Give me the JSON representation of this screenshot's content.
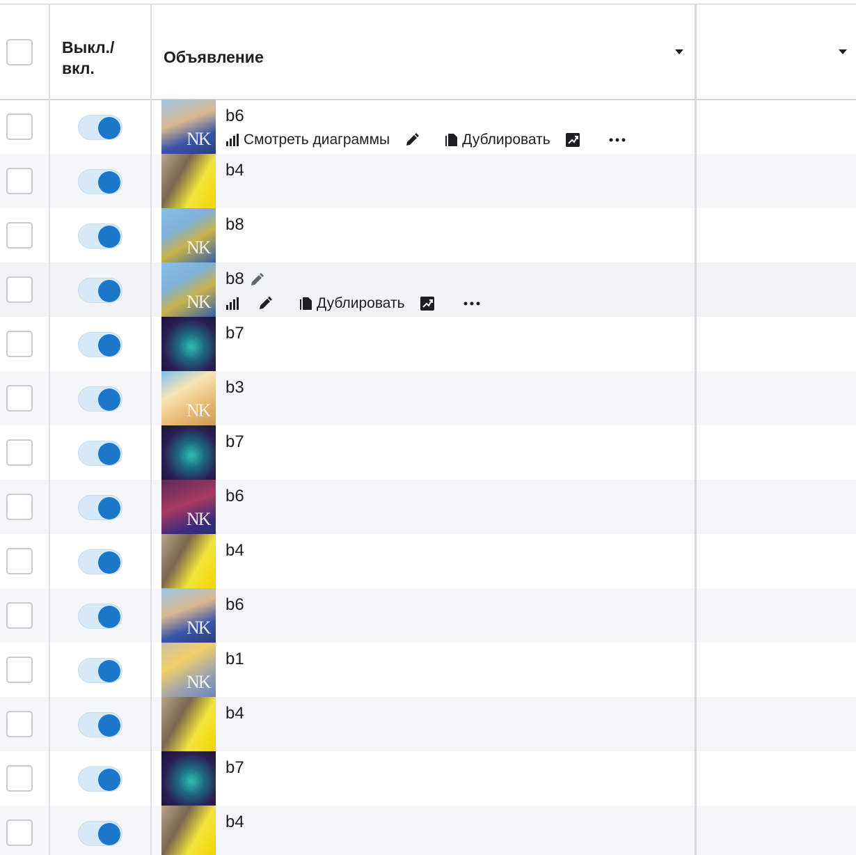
{
  "header": {
    "toggle_col_label": "Выкл./\nвкл.",
    "ad_col_label": "Объявление"
  },
  "hover_actions": {
    "view_charts": "Смотреть диаграммы",
    "duplicate": "Дублировать"
  },
  "icons": {
    "charts": "bar-chart-icon",
    "edit": "pencil-icon",
    "duplicate": "duplicate-icon",
    "insights": "trend-icon",
    "more": "more-dots-icon",
    "sort": "caret-down-icon"
  },
  "colors": {
    "toggle_on": "#1a77c9",
    "toggle_track": "#d6e9f7",
    "row_alt": "#f5f6f7",
    "border": "#dddfe2"
  },
  "rows": [
    {
      "name": "b6",
      "on": true
    },
    {
      "name": "b4",
      "on": true
    },
    {
      "name": "b8",
      "on": true
    },
    {
      "name": "b8",
      "on": true
    },
    {
      "name": "b7",
      "on": true
    },
    {
      "name": "b3",
      "on": true
    },
    {
      "name": "b7",
      "on": true
    },
    {
      "name": "b6",
      "on": true
    },
    {
      "name": "b4",
      "on": true
    },
    {
      "name": "b6",
      "on": true
    },
    {
      "name": "b1",
      "on": true
    },
    {
      "name": "b4",
      "on": true
    },
    {
      "name": "b7",
      "on": true
    },
    {
      "name": "b4",
      "on": true
    }
  ]
}
